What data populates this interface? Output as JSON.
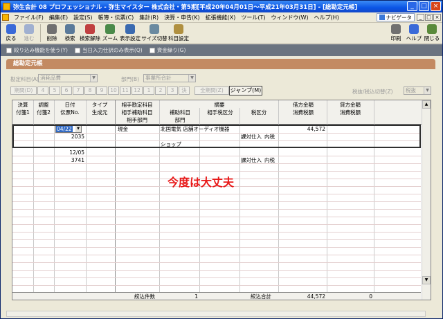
{
  "window": {
    "title": "弥生会計 08 プロフェッショナル - 弥生マイスター 株式会社・第5期[平成20年04月01日～平成21年03月31日] - [総勘定元帳]",
    "buttons": [
      "_",
      "□",
      "×"
    ]
  },
  "menu": {
    "items": [
      "ファイル(F)",
      "編集(E)",
      "設定(S)",
      "帳簿・伝票(C)",
      "集計(R)",
      "決算・申告(K)",
      "拡張機能(X)",
      "ツール(T)",
      "ウィンドウ(W)",
      "ヘルプ(H)"
    ],
    "navi_label": "ナビゲータ",
    "mdi_buttons": [
      "_",
      "□",
      "×"
    ]
  },
  "toolbar": {
    "buttons": [
      {
        "label": "戻る",
        "icon": "back-arrow-icon",
        "color": "#3a6ad8",
        "enabled": true
      },
      {
        "label": "進む",
        "icon": "forward-arrow-icon",
        "color": "#a0b0d0",
        "enabled": false
      },
      {
        "label": "削除",
        "icon": "delete-icon",
        "color": "#707070",
        "enabled": true
      },
      {
        "label": "検索",
        "icon": "search-icon",
        "color": "#5a7a9a",
        "enabled": true
      },
      {
        "label": "検索解除",
        "icon": "search-clear-icon",
        "color": "#c04040",
        "enabled": true
      },
      {
        "label": "ズーム",
        "icon": "zoom-icon",
        "color": "#4a8a4a",
        "enabled": true
      },
      {
        "label": "表示設定",
        "icon": "display-settings-icon",
        "color": "#3a6ab0",
        "enabled": true
      },
      {
        "label": "サイズ切替",
        "icon": "size-toggle-icon",
        "color": "#6a8aa0",
        "enabled": true
      },
      {
        "label": "科目設定",
        "icon": "account-settings-icon",
        "color": "#b09040",
        "enabled": true
      }
    ],
    "right_buttons": [
      {
        "label": "印刷",
        "icon": "print-icon",
        "color": "#707070"
      },
      {
        "label": "ヘルプ",
        "icon": "help-icon",
        "color": "#3a6ad8"
      },
      {
        "label": "閉じる",
        "icon": "close-door-icon",
        "color": "#5a8a3a"
      }
    ]
  },
  "filters": [
    "絞り込み機能を使う(Y)",
    "当日入力仕訳のみ表示(Q)",
    "資金繰り(G)"
  ],
  "panel": {
    "title": "総勘定元帳",
    "account_label": "勘定科目(A)",
    "account_value": "消耗品費",
    "dept_label": "部門(B)",
    "dept_value": "事業所合計",
    "months": [
      "期間(D)",
      "4",
      "5",
      "6",
      "7",
      "8",
      "9",
      "10",
      "11",
      "12",
      "1",
      "2",
      "3",
      "決"
    ],
    "all_period": "全期間(Z)",
    "jump": "ジャンプ(M)",
    "tax_label": "税抜/税込切替(Z)",
    "tax_value": "税抜"
  },
  "grid": {
    "headers_row1": [
      "決算",
      "調整",
      "日付",
      "タイプ",
      "相手勘定科目",
      "摘要",
      "借方金額",
      "貸方金額"
    ],
    "headers_row2": [
      "付箋1",
      "付箋2",
      "伝票No.",
      "生成元",
      "相手補助科目",
      "補助科目",
      "相手税区分",
      "税区分",
      "消費税額",
      "消費税額"
    ],
    "headers_row3": [
      "相手部門",
      "部門"
    ],
    "rows": [
      {
        "date": "04/22",
        "slip": "2035",
        "partner_account": "現金",
        "desc": "北国電気 店舗オーディオ機器",
        "tax_class": "課対仕入",
        "tax_type": "内税",
        "debit": "44,572",
        "memo": "ショップ"
      },
      {
        "date": "12/05",
        "slip": "3741",
        "tax_class": "課対仕入",
        "tax_type": "内税"
      }
    ],
    "annotation": "今度は大丈夫",
    "footer": {
      "count_label": "絞込件数",
      "count": "1",
      "total_label": "絞込合計",
      "debit_total": "44,572",
      "credit_total": "0"
    }
  }
}
